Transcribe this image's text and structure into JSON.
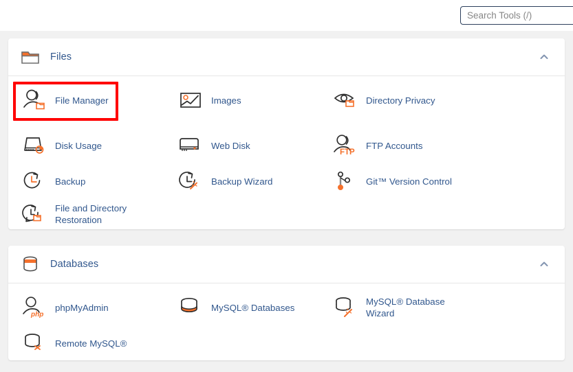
{
  "search": {
    "placeholder": "Search Tools (/)",
    "value": ""
  },
  "colors": {
    "accent_orange": "#f5712c",
    "link_blue": "#31578d",
    "highlight_red": "#ff0000",
    "page_background": "#f1f1f1",
    "panel_background": "#ffffff",
    "icon_stroke": "#2f2f2f"
  },
  "sections": [
    {
      "id": "files",
      "title": "Files",
      "icon": "folder-icon",
      "collapse_icon": "chevron-up-icon",
      "items": [
        {
          "label": "File Manager",
          "icon": "file-manager-icon",
          "highlighted": true
        },
        {
          "label": "Images",
          "icon": "images-icon",
          "highlighted": false
        },
        {
          "label": "Directory Privacy",
          "icon": "directory-privacy-icon",
          "highlighted": false
        },
        {
          "label": "Disk Usage",
          "icon": "disk-usage-icon",
          "highlighted": false
        },
        {
          "label": "Web Disk",
          "icon": "web-disk-icon",
          "highlighted": false
        },
        {
          "label": "FTP Accounts",
          "icon": "ftp-accounts-icon",
          "highlighted": false
        },
        {
          "label": "Backup",
          "icon": "backup-icon",
          "highlighted": false
        },
        {
          "label": "Backup Wizard",
          "icon": "backup-wizard-icon",
          "highlighted": false
        },
        {
          "label": "Git™ Version Control",
          "icon": "git-version-control-icon",
          "highlighted": false
        },
        {
          "label": "File and Directory Restoration",
          "icon": "file-directory-restoration-icon",
          "highlighted": false
        }
      ]
    },
    {
      "id": "databases",
      "title": "Databases",
      "icon": "database-icon",
      "collapse_icon": "chevron-up-icon",
      "items": [
        {
          "label": "phpMyAdmin",
          "icon": "phpmyadmin-icon",
          "highlighted": false
        },
        {
          "label": "MySQL® Databases",
          "icon": "mysql-databases-icon",
          "highlighted": false
        },
        {
          "label": "MySQL® Database Wizard",
          "icon": "mysql-database-wizard-icon",
          "highlighted": false
        },
        {
          "label": "Remote MySQL®",
          "icon": "remote-mysql-icon",
          "highlighted": false
        }
      ]
    }
  ]
}
